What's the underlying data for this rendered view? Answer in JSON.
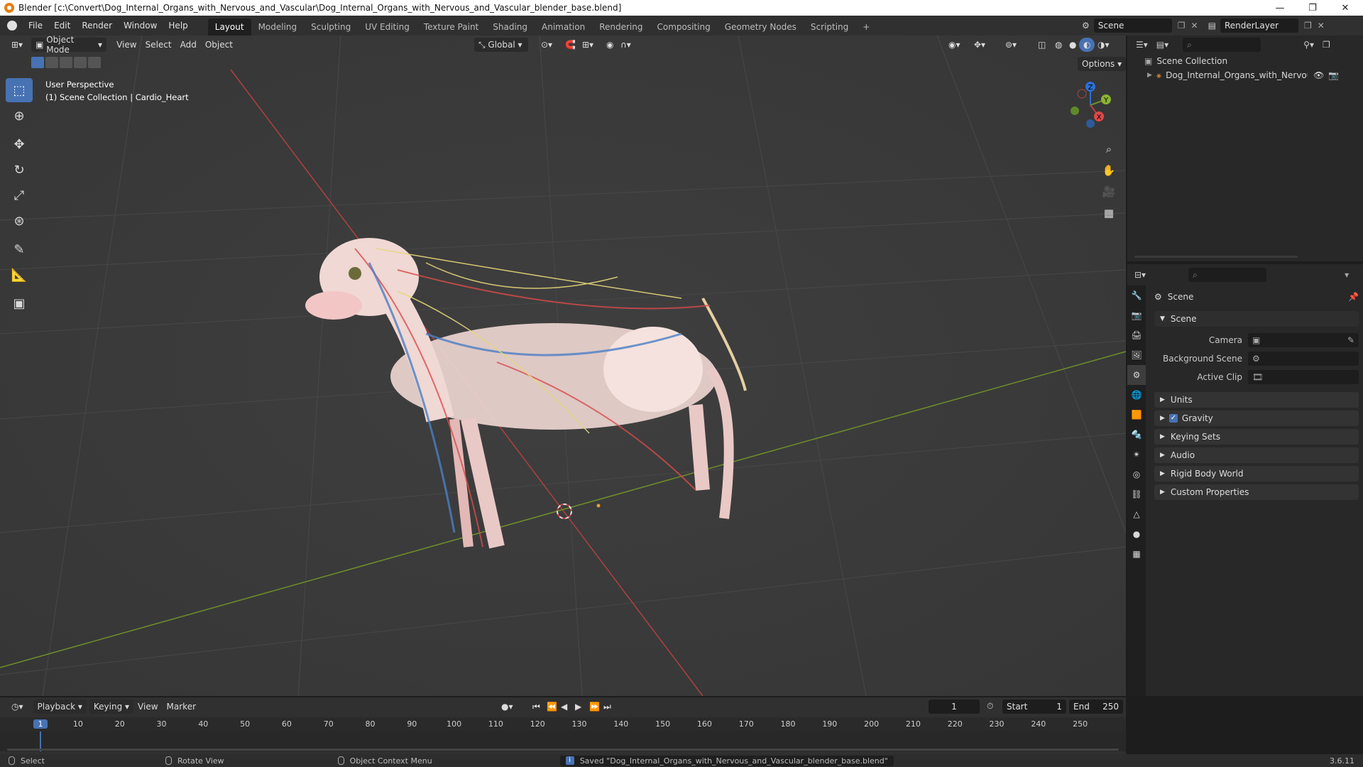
{
  "title": "Blender [c:\\Convert\\Dog_Internal_Organs_with_Nervous_and_Vascular\\Dog_Internal_Organs_with_Nervous_and_Vascular_blender_base.blend]",
  "menu": [
    "File",
    "Edit",
    "Render",
    "Window",
    "Help"
  ],
  "workspaces": [
    "Layout",
    "Modeling",
    "Sculpting",
    "UV Editing",
    "Texture Paint",
    "Shading",
    "Animation",
    "Rendering",
    "Compositing",
    "Geometry Nodes",
    "Scripting"
  ],
  "active_workspace": "Layout",
  "scene_name": "Scene",
  "render_layer": "RenderLayer",
  "viewport": {
    "mode": "Object Mode",
    "menus": [
      "View",
      "Select",
      "Add",
      "Object"
    ],
    "orientation": "Global",
    "options_label": "Options",
    "perspective": "User Perspective",
    "collection_info": "(1) Scene Collection | Cardio_Heart",
    "axes": {
      "x": "X",
      "y": "Y",
      "z": "Z"
    }
  },
  "outliner": {
    "root": "Scene Collection",
    "items": [
      {
        "name": "Dog_Internal_Organs_with_Nervous_anc"
      }
    ]
  },
  "properties": {
    "context": "Scene",
    "section": "Scene",
    "fields": [
      {
        "label": "Camera",
        "value": ""
      },
      {
        "label": "Background Scene",
        "value": ""
      },
      {
        "label": "Active Clip",
        "value": ""
      }
    ],
    "panels": [
      "Units",
      "Gravity",
      "Keying Sets",
      "Audio",
      "Rigid Body World",
      "Custom Properties"
    ]
  },
  "timeline": {
    "menus": [
      "Playback",
      "Keying",
      "View",
      "Marker"
    ],
    "current_frame": "1",
    "start_label": "Start",
    "start": "1",
    "end_label": "End",
    "end": "250",
    "ticks": [
      "1",
      "10",
      "20",
      "30",
      "40",
      "50",
      "60",
      "70",
      "80",
      "90",
      "100",
      "110",
      "120",
      "130",
      "140",
      "150",
      "160",
      "170",
      "180",
      "190",
      "200",
      "210",
      "220",
      "230",
      "240",
      "250"
    ]
  },
  "status": {
    "select": "Select",
    "rotate": "Rotate View",
    "context_menu": "Object Context Menu",
    "message": "Saved \"Dog_Internal_Organs_with_Nervous_and_Vascular_blender_base.blend\"",
    "version": "3.6.11"
  },
  "colors": {
    "accent": "#4772b3",
    "x_axis": "#c23b3b",
    "y_axis": "#6a8f2a",
    "z_axis": "#2f6fd4"
  },
  "icons": [
    "blender-logo-icon",
    "cursor-icon",
    "move-icon",
    "rotate-icon",
    "scale-icon",
    "transform-icon",
    "annotate-icon",
    "measure-icon",
    "add-cube-icon",
    "zoom-icon",
    "hand-icon",
    "camera-icon",
    "grid-icon",
    "eye-icon",
    "camera-render-icon"
  ]
}
